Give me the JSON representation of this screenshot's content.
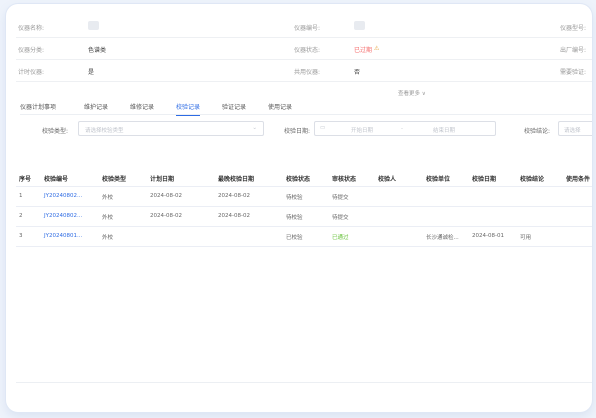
{
  "info": {
    "row1": {
      "name_label": "仪器名称:",
      "code_label": "仪器编号:",
      "right_label": "仪器型号:"
    },
    "row2": {
      "category_label": "仪器分类:",
      "category_value": "色谱类",
      "status_label": "仪器状态:",
      "status_value": "已过期",
      "right_label": "出厂编号:"
    },
    "row3": {
      "metering_label": "计时仪器:",
      "metering_value": "是",
      "shared_label": "共用仪器:",
      "shared_value": "否",
      "right_label": "需要验证:"
    }
  },
  "more_label": "查看更多 ∨",
  "tabs": [
    {
      "label": "仪器计划事项"
    },
    {
      "label": "维护记录"
    },
    {
      "label": "维修记录"
    },
    {
      "label": "校验记录"
    },
    {
      "label": "验证记录"
    },
    {
      "label": "使用记录"
    }
  ],
  "filters": {
    "type_label": "校验类型:",
    "type_placeholder": "请选择校验类型",
    "date_label": "校验日期:",
    "start_placeholder": "开始日期",
    "separator": "-",
    "end_placeholder": "结束日期",
    "result_label": "校验结论:",
    "result_placeholder": "请选择"
  },
  "table": {
    "headers": [
      "序号",
      "校验编号",
      "校验类型",
      "计划日期",
      "最晚校验日期",
      "校验状态",
      "审核状态",
      "校验人",
      "校验单位",
      "校验日期",
      "校验结论",
      "使用条件"
    ],
    "rows": [
      [
        "1",
        "JY20240802...",
        "外校",
        "2024-08-02",
        "2024-08-02",
        "待校验",
        "待提交",
        "",
        "",
        "",
        "",
        ""
      ],
      [
        "2",
        "JY20240802...",
        "外校",
        "2024-08-02",
        "2024-08-02",
        "待校验",
        "待提交",
        "",
        "",
        "",
        "",
        ""
      ],
      [
        "3",
        "JY20240801...",
        "外校",
        "",
        "",
        "已校验",
        "已通过",
        "",
        "长沙通诚检...",
        "2024-08-01",
        "可用",
        ""
      ]
    ]
  },
  "colors": {
    "accent": "#2d6be4",
    "danger": "#f56c6c",
    "warning": "#e6a23c",
    "success": "#67c23a"
  }
}
